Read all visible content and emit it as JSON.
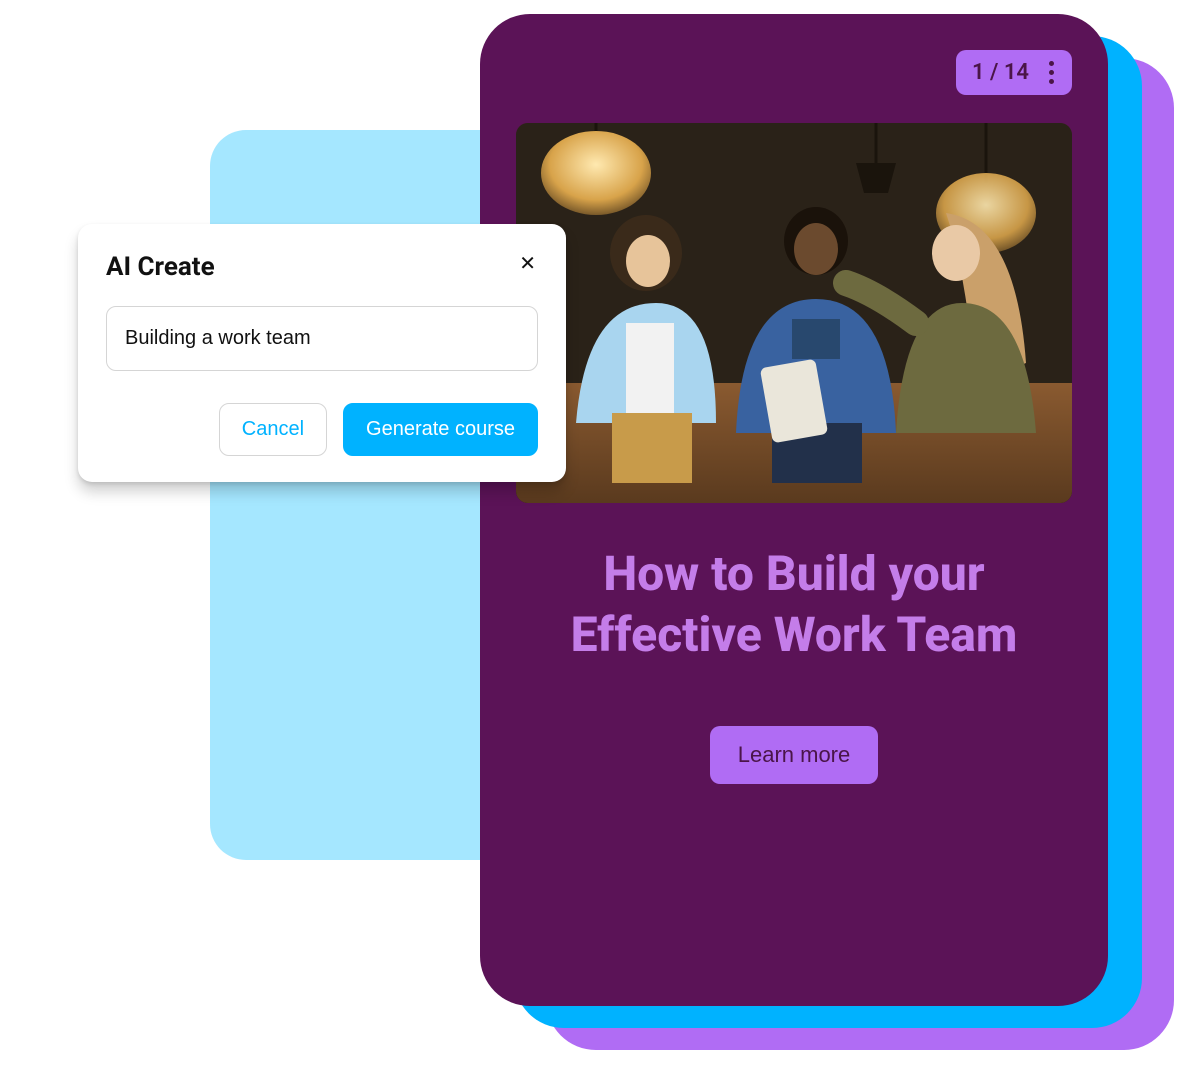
{
  "modal": {
    "title": "AI Create",
    "input_value": "Building a work team",
    "cancel_label": "Cancel",
    "generate_label": "Generate course"
  },
  "phone": {
    "page_indicator": "1 / 14",
    "title": "How to Build your Effective Work Team",
    "learn_more_label": "Learn more"
  }
}
